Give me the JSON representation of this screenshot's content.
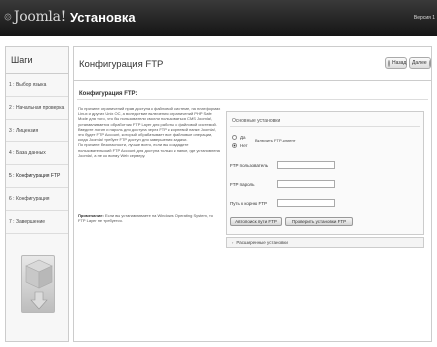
{
  "header": {
    "logo_text": "Joomla!",
    "title": "Установка",
    "version": "Версия 1"
  },
  "sidebar": {
    "title": "Шаги",
    "steps": [
      "1 : Выбор языка",
      "2 : Начальная проверка",
      "3 : Лицензия",
      "4 : База данных",
      "5 : Конфигурация FTP",
      "6 : Конфигурация",
      "7 : Завершение"
    ]
  },
  "main": {
    "title": "Конфигурация FTP",
    "back_label": "Назад",
    "next_label": "Далее",
    "section_title": "Конфигурация FTP:",
    "info_paragraphs": [
      "По причине ограничений прав доступа к файловой системе, на платформах Linux и других Unix ОС, а вследствие включения ограничений PHP Safe Mode для того, что бы пользователи смогли пользоваться CMS Joomla!, устанавливается обработчик FTP Layer для работы с файловой системой. Введите логин и пароль для доступа через FTP к корневой папке Joomla!, это будет FTP Account, который обрабатывает все файловые операции, когда Joomla! требует FTP доступ для завершения задачи.",
      "По причине безопасности, лучше всего, если вы создадите пользовательский FTP Account для доступа только к папке, где установлена Joomla!, а не ко всему Web серверу."
    ],
    "note_label": "Примечание:",
    "note_text": "Если вы устанавливаете на Windows Operating System, то FTP Layer не требуется."
  },
  "ftp": {
    "box_title": "Основные установки",
    "radio_yes": "Да",
    "radio_no": "Нет",
    "enable_label": "Включить FTP-клиент",
    "user_label": "FTP пользователь",
    "password_label": "FTP пароль",
    "path_label": "Путь к корню FTP",
    "user_value": "",
    "password_value": "",
    "path_value": "",
    "autofind_button": "Автопоиск пути FTP",
    "verify_button": "Проверить установки FTP",
    "advanced_label": "Расширенные установки"
  }
}
